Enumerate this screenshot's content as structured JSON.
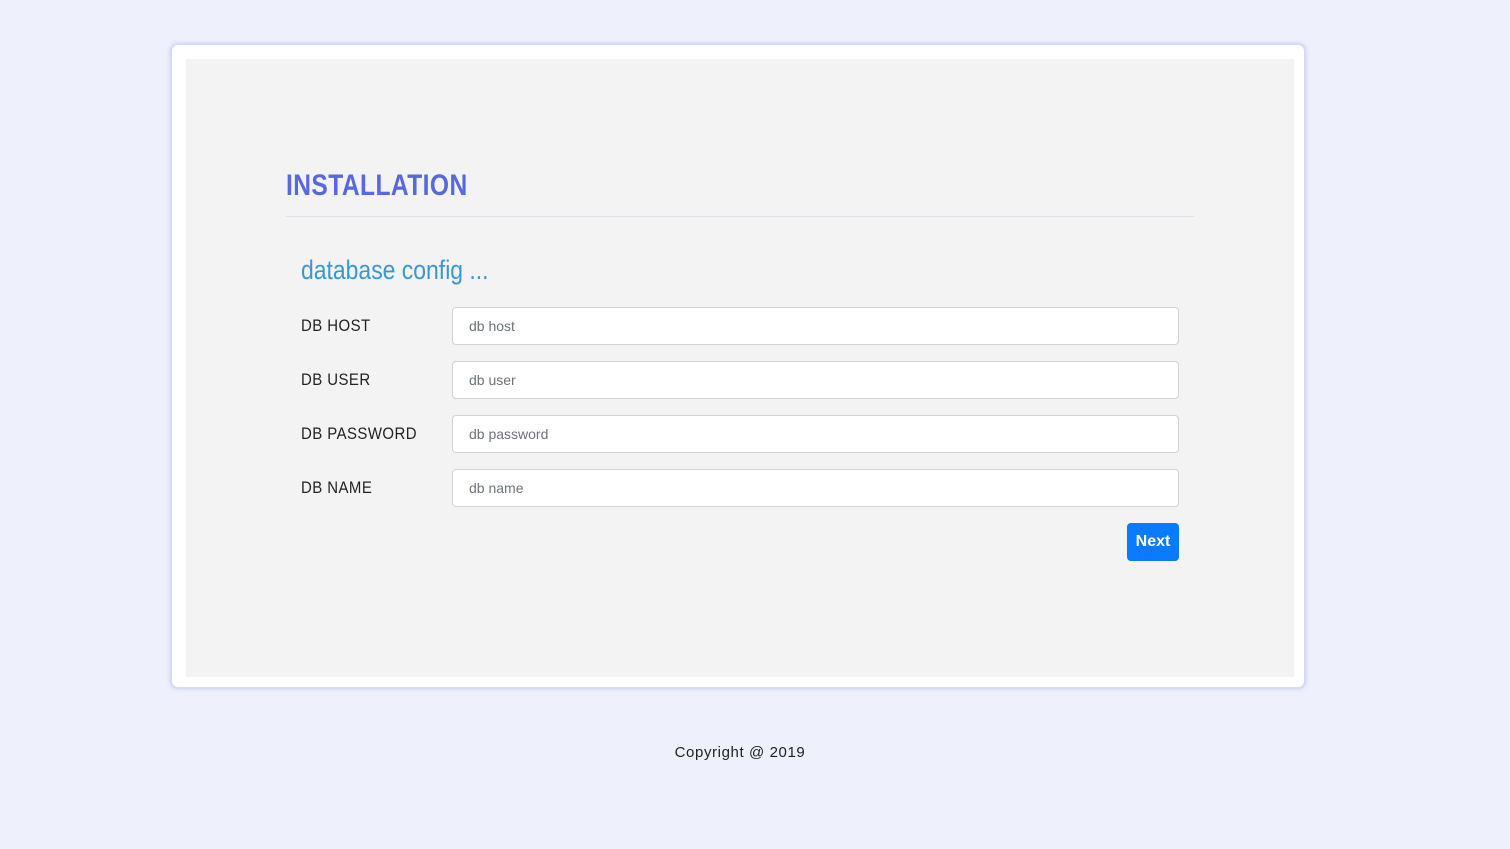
{
  "install": {
    "title": "INSTALLATION",
    "subtitle": "database config ...",
    "fields": [
      {
        "label": "DB HOST",
        "placeholder": "db host",
        "value": ""
      },
      {
        "label": "DB USER",
        "placeholder": "db user",
        "value": ""
      },
      {
        "label": "DB PASSWORD",
        "placeholder": "db password",
        "value": ""
      },
      {
        "label": "DB NAME",
        "placeholder": "db name",
        "value": ""
      }
    ],
    "next_label": "Next"
  },
  "footer": {
    "copyright": "Copyright @ 2019"
  },
  "colors": {
    "page_bg": "#eef0fb",
    "panel_bg": "#f3f3f3",
    "title": "#5868de",
    "subtitle": "#3b97d3",
    "button": "#0a7bff"
  }
}
